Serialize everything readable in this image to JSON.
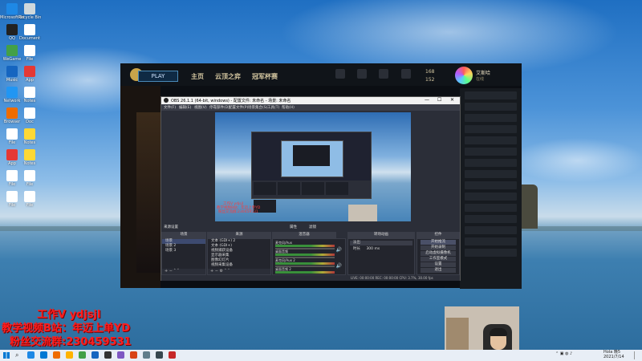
{
  "desktop": {
    "icons": [
      {
        "label": "Microsoft Edge",
        "color": "#1e88e5"
      },
      {
        "label": "Recycle Bin",
        "color": "#cfd8dc"
      },
      {
        "label": "QQ",
        "color": "#222222"
      },
      {
        "label": "Document",
        "color": "#ffffff"
      },
      {
        "label": "WeGame",
        "color": "#43a047"
      },
      {
        "label": "File",
        "color": "#ffffff"
      },
      {
        "label": "Music",
        "color": "#1565c0"
      },
      {
        "label": "App",
        "color": "#e53935"
      },
      {
        "label": "Network",
        "color": "#2196f3"
      },
      {
        "label": "Notes",
        "color": "#ffffff"
      },
      {
        "label": "Browser",
        "color": "#ef6c00"
      },
      {
        "label": "Doc",
        "color": "#ffffff"
      },
      {
        "label": "File",
        "color": "#ffffff"
      },
      {
        "label": "Notes",
        "color": "#fdd835"
      },
      {
        "label": "App",
        "color": "#e53935"
      },
      {
        "label": "Notes",
        "color": "#fdd835"
      },
      {
        "label": "File",
        "color": "#ffffff"
      },
      {
        "label": "File",
        "color": "#ffffff"
      },
      {
        "label": "File",
        "color": "#ffffff"
      },
      {
        "label": "File",
        "color": "#ffffff"
      }
    ]
  },
  "game": {
    "play_label": "PLAY",
    "nav": [
      "主页",
      "云顶之弈",
      "冠军杯赛"
    ],
    "currency_1": "168",
    "currency_2": "152",
    "profile_name": "艾斯哈",
    "profile_status": "在线"
  },
  "obs": {
    "title": "OBS 26.1.1 (64-bit, windows) - 配置文件: 未命名 - 场景: 未命名",
    "menu": [
      "文件(F)",
      "编辑(E)",
      "视图(V)",
      "停靠部件(D)",
      "配置文件(P)",
      "场景集合(S)",
      "工具(T)",
      "帮助(H)"
    ],
    "window_controls": [
      "—",
      "☐",
      "✕"
    ],
    "preview_overlay": [
      "工作V ydjsjl",
      "教学视频B站：年迈上单YD",
      "粉丝交流群:230459531"
    ],
    "mixer_bar": {
      "left": "来源设置",
      "mid": "属性",
      "right": "滤镜"
    },
    "docks": {
      "scenes": {
        "header": "场景",
        "items": [
          "场景",
          "场景 2",
          "场景 3"
        ]
      },
      "sources": {
        "header": "来源",
        "items": [
          "文本 (GDI+) 2",
          "文本 (GDI+)",
          "视频捕获设备",
          "显示器采集",
          "图像幻灯片",
          "视频采集设备"
        ]
      },
      "mixer": {
        "header": "混音器",
        "channels": [
          "麦克风/Aux",
          "桌面音频",
          "麦克风/Aux 2",
          "桌面音频 2"
        ]
      },
      "transitions": {
        "header": "转场动画",
        "type": "淡出",
        "duration_label": "时长",
        "duration": "300 ms"
      },
      "controls": {
        "header": "控件",
        "buttons": [
          "开始推流",
          "开始录制",
          "启动虚拟摄像机",
          "工作室模式",
          "设置",
          "退出"
        ]
      }
    },
    "status": "LIVE: 00:00:00   REC: 00:00:00   CPU: 3.7%, 30.00 fps"
  },
  "overlay_text": {
    "line1": "工作V ydjsjl",
    "line2": "教学视频B站：年迈上单YD",
    "line3": "粉丝交流群:230459531"
  },
  "taskbar": {
    "search_icon": "search-icon",
    "apps": [
      "#1e88e5",
      "#0078d4",
      "#ef6c00",
      "#ffb300",
      "#43a047",
      "#1565c0",
      "#333333",
      "#7e57c2",
      "#d84315",
      "#607d8b",
      "#37474f",
      "#c62828"
    ],
    "time": "Hola 晚5",
    "date": "2021/7/14"
  }
}
